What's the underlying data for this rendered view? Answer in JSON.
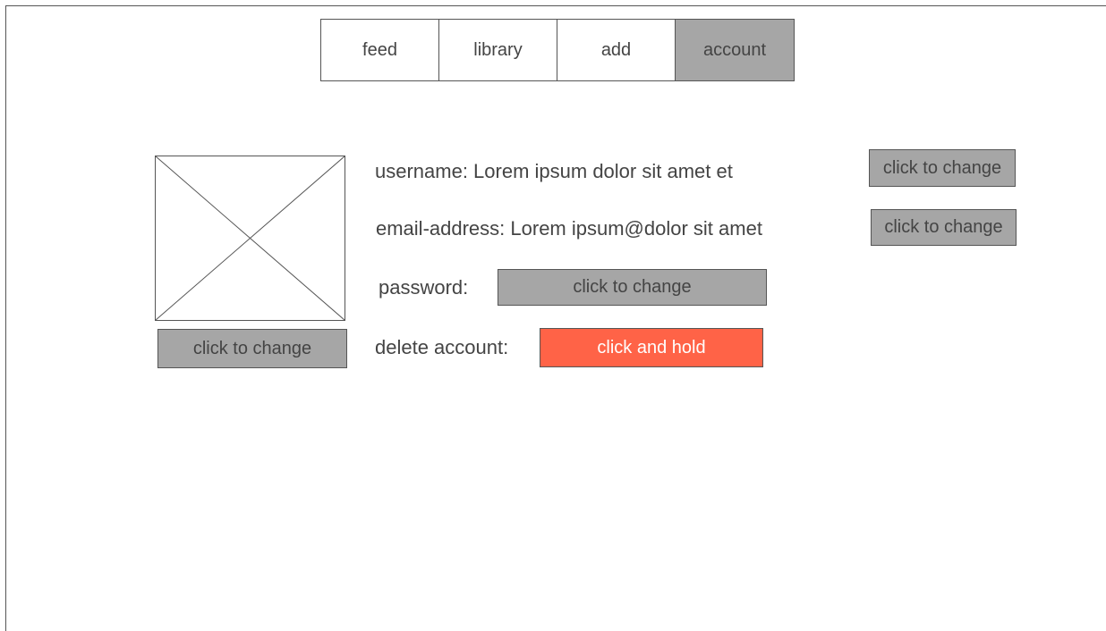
{
  "nav": {
    "tabs": [
      {
        "label": "feed"
      },
      {
        "label": "library"
      },
      {
        "label": "add"
      },
      {
        "label": "account"
      }
    ],
    "active_index": 3
  },
  "avatar": {
    "icon": "image-placeholder-icon",
    "change_label": "click to change"
  },
  "account": {
    "username_text": "username: Lorem ipsum dolor sit amet et",
    "username_change_label": "click to change",
    "email_text": "email-address: Lorem ipsum@dolor sit amet",
    "email_change_label": "click to change",
    "password_label": "password:",
    "password_change_label": "click to change",
    "delete_label": "delete account:",
    "delete_button_label": "click and hold"
  },
  "colors": {
    "button_gray": "#a6a6a6",
    "danger_red": "#ff6347",
    "border": "#555555",
    "text": "#444444"
  }
}
